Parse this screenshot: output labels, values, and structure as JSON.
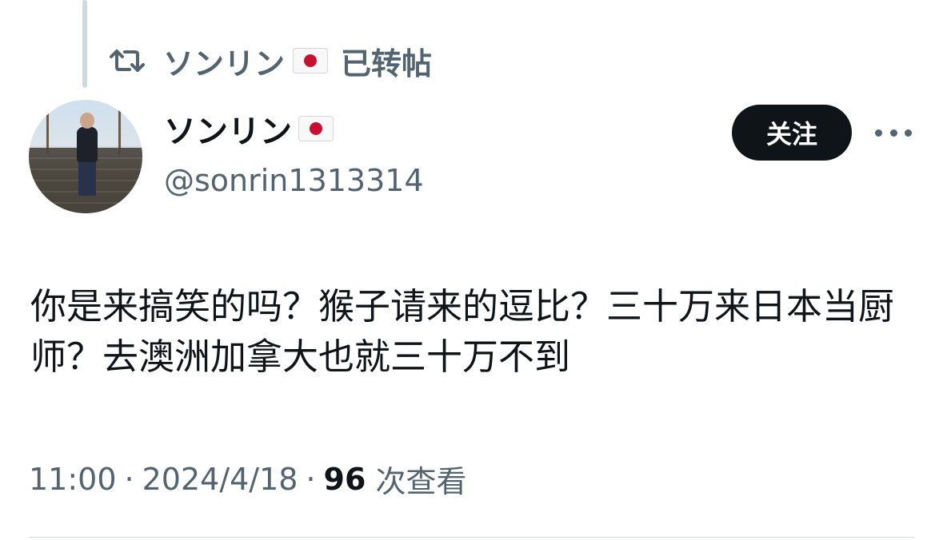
{
  "repost": {
    "icon": "repost-icon",
    "user_name": "ソンリン",
    "flag": "jp-flag",
    "label": "已转帖"
  },
  "author": {
    "display_name": "ソンリン",
    "flag": "jp-flag",
    "handle": "@sonrin1313314",
    "avatar": "avatar-photo"
  },
  "actions": {
    "follow_label": "关注",
    "more_icon": "more-icon"
  },
  "tweet": {
    "text": "你是来搞笑的吗？猴子请来的逗比？三十万来日本当厨师？去澳洲加拿大也就三十万不到"
  },
  "meta": {
    "time": "11:00",
    "separator": "·",
    "date": "2024/4/18",
    "views_count": "96",
    "views_label": "次查看"
  },
  "colors": {
    "primary_text": "#0f1419",
    "secondary_text": "#536471",
    "follow_button_bg": "#0f1419",
    "divider": "#cfd9de"
  }
}
